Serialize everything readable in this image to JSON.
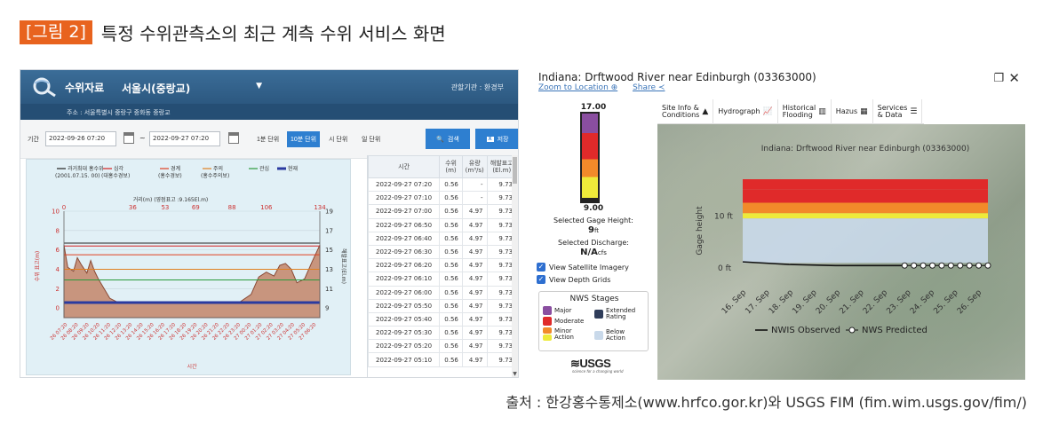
{
  "figure": {
    "tag": "[그림 2]",
    "title": "특정 수위관측소의 최근 계측 수위 서비스 화면",
    "caption": "출처 : 한강홍수통제소(www.hrfco.gor.kr)와 USGS FIM (fim.wim.usgs.gov/fim/)"
  },
  "hrfco": {
    "category": "수위자료",
    "station": "서울시(중랑교)",
    "agency": "관할기관 : 환경부",
    "address": "주소 : 서울특별시 중랑구 중화동 중랑교",
    "period_label": "기간",
    "start_date": "2022-09-26 07:20",
    "end_date": "2022-09-27 07:20",
    "tilde": "~",
    "units": [
      "1분 단위",
      "10분 단위",
      "시 단위",
      "일 단위"
    ],
    "active_unit_index": 1,
    "search_label": "검색",
    "save_label": "저장",
    "colors": {
      "header": "#2c5880",
      "button": "#2e7fd0"
    },
    "legend": [
      {
        "label": "과거최대 홍수위",
        "sub": "(2001.07.15. 00)",
        "color": "#222222"
      },
      {
        "label": "심각",
        "sub": "(대홍수경보)",
        "color": "#d62020"
      },
      {
        "label": "경계",
        "sub": "(홍수경보)",
        "color": "#e04020"
      },
      {
        "label": "주의",
        "sub": "(홍수주의보)",
        "color": "#e08020"
      },
      {
        "label": "관심",
        "sub": "",
        "color": "#2a9a3a"
      },
      {
        "label": "현재",
        "sub": "",
        "color": "#2a3aa0"
      }
    ],
    "table": {
      "headers": [
        "시간",
        "수위\n(m)",
        "유량\n(m³/s)",
        "해발표고\n(El.m)"
      ],
      "rows": [
        [
          "2022-09-27 07:20",
          "0.56",
          "-",
          "9.73"
        ],
        [
          "2022-09-27 07:10",
          "0.56",
          "-",
          "9.73"
        ],
        [
          "2022-09-27 07:00",
          "0.56",
          "4.97",
          "9.73"
        ],
        [
          "2022-09-27 06:50",
          "0.56",
          "4.97",
          "9.73"
        ],
        [
          "2022-09-27 06:40",
          "0.56",
          "4.97",
          "9.73"
        ],
        [
          "2022-09-27 06:30",
          "0.56",
          "4.97",
          "9.73"
        ],
        [
          "2022-09-27 06:20",
          "0.56",
          "4.97",
          "9.73"
        ],
        [
          "2022-09-27 06:10",
          "0.56",
          "4.97",
          "9.73"
        ],
        [
          "2022-09-27 06:00",
          "0.56",
          "4.97",
          "9.73"
        ],
        [
          "2022-09-27 05:50",
          "0.56",
          "4.97",
          "9.73"
        ],
        [
          "2022-09-27 05:40",
          "0.56",
          "4.97",
          "9.73"
        ],
        [
          "2022-09-27 05:30",
          "0.56",
          "4.97",
          "9.73"
        ],
        [
          "2022-09-27 05:20",
          "0.56",
          "4.97",
          "9.73"
        ],
        [
          "2022-09-27 05:10",
          "0.56",
          "4.97",
          "9.73"
        ]
      ]
    }
  },
  "usgs": {
    "title": "Indiana: Drftwood River near Edinburgh (03363000)",
    "zoom_link": "Zoom to Location",
    "share_link": "Share",
    "gage_top": "17.00",
    "gage_bottom": "9.00",
    "selected_height_label": "Selected Gage Height:",
    "selected_height_value": "9",
    "selected_height_unit": "ft",
    "selected_discharge_label": "Selected Discharge:",
    "selected_discharge_value": "N/A",
    "selected_discharge_unit": "cfs",
    "view_satellite": "View Satellite Imagery",
    "view_depth": "View Depth Grids",
    "stages_title": "NWS Stages",
    "stage_labels": {
      "major": "Major",
      "moderate": "Moderate",
      "minor": "Minor\nAction",
      "extended": "Extended\nRating",
      "below": "Below\nAction"
    },
    "stage_colors": {
      "major": "#8a4ea0",
      "moderate": "#e02a2a",
      "minor": "#f28a2a",
      "action": "#eeea3a",
      "extended": "#2f3d5a",
      "below": "#c9d9ea"
    },
    "usgs_logo": "≋USGS",
    "usgs_tagline": "science for a changing world",
    "tabs": [
      {
        "label": "Site Info &\nConditions",
        "icon": "triangle-icon"
      },
      {
        "label": "Hydrograph",
        "icon": "line-chart-icon"
      },
      {
        "label": "Historical\nFlooding",
        "icon": "bar-chart-icon"
      },
      {
        "label": "Hazus",
        "icon": "building-icon"
      },
      {
        "label": "Services\n& Data",
        "icon": "list-icon"
      }
    ],
    "legend": {
      "observed": "NWIS Observed",
      "predicted": "NWS Predicted"
    }
  },
  "chart_data": [
    {
      "type": "area",
      "title": "",
      "top_axis_label": "거리(m) (영점표고 :9.165El.m)",
      "top_ticks": [
        0,
        36,
        53,
        69,
        88,
        106,
        134
      ],
      "ylabel": "수위 표고(m)",
      "y2label": "해발표고(El.m)",
      "ylim": [
        -1,
        10
      ],
      "y_ticks": [
        0,
        2,
        4,
        6,
        8,
        10
      ],
      "y2_ticks": [
        9,
        11,
        13,
        15,
        17,
        19
      ],
      "xlabel": "시간",
      "x": [
        "26 07:20",
        "26 08:20",
        "26 09:20",
        "26 10:20",
        "26 11:20",
        "26 12:20",
        "26 13:20",
        "26 14:20",
        "26 15:20",
        "26 16:20",
        "26 17:20",
        "26 18:20",
        "26 19:20",
        "26 20:20",
        "26 21:20",
        "26 22:20",
        "26 23:20",
        "27 00:20",
        "27 01:20",
        "27 02:20",
        "27 03:20",
        "27 04:20",
        "27 05:20",
        "27 06:20"
      ],
      "threshold_lines": [
        {
          "name": "과거최대 홍수위",
          "value": 6.7
        },
        {
          "name": "심각",
          "value": 6.4
        },
        {
          "name": "경계",
          "value": 5.5
        },
        {
          "name": "주의",
          "value": 4.0
        },
        {
          "name": "관심",
          "value": 2.9
        },
        {
          "name": "현재",
          "value": 0.56
        }
      ],
      "cross_section_profile": [
        [
          0,
          6.5
        ],
        [
          2,
          4.2
        ],
        [
          5,
          3.8
        ],
        [
          7,
          5.2
        ],
        [
          9,
          4.5
        ],
        [
          12,
          3.6
        ],
        [
          14,
          4.9
        ],
        [
          16,
          3.8
        ],
        [
          18,
          3.0
        ],
        [
          21,
          2.0
        ],
        [
          24,
          1.0
        ],
        [
          28,
          0.6
        ],
        [
          50,
          0.6
        ],
        [
          70,
          0.6
        ],
        [
          92,
          0.6
        ],
        [
          98,
          1.4
        ],
        [
          102,
          3.2
        ],
        [
          106,
          3.7
        ],
        [
          110,
          3.3
        ],
        [
          113,
          4.4
        ],
        [
          116,
          4.6
        ],
        [
          119,
          4.0
        ],
        [
          122,
          2.6
        ],
        [
          126,
          3.0
        ],
        [
          130,
          4.8
        ],
        [
          134,
          6.5
        ]
      ]
    },
    {
      "type": "line",
      "title": "Indiana: Drftwood River near Edinburgh (03363000)",
      "ylabel": "Gage height",
      "y_ticks_label": [
        "0 ft",
        "10 ft"
      ],
      "ylim": [
        -2,
        17
      ],
      "x_ticks": [
        "16. Sep",
        "17. Sep",
        "18. Sep",
        "19. Sep",
        "20. Sep",
        "21. Sep",
        "22. Sep",
        "23. Sep",
        "24. Sep",
        "25. Sep",
        "26. Sep"
      ],
      "bands": [
        {
          "name": "Major",
          "from": 15,
          "to": 17
        },
        {
          "name": "Moderate",
          "from": 12.5,
          "to": 15
        },
        {
          "name": "Minor",
          "from": 10.5,
          "to": 12.5
        },
        {
          "name": "Action",
          "from": 9.5,
          "to": 10.5
        },
        {
          "name": "Below Action",
          "from": 1,
          "to": 9.5
        }
      ],
      "series": [
        {
          "name": "NWIS Observed",
          "x": [
            0,
            2,
            4,
            6,
            7
          ],
          "y": [
            1.2,
            0.7,
            0.5,
            0.5,
            0.5
          ]
        },
        {
          "name": "NWS Predicted",
          "x": [
            7,
            7.4,
            7.8,
            8.2,
            8.6,
            9,
            9.4,
            9.8,
            10.2,
            10.6
          ],
          "y": [
            0.5,
            0.5,
            0.5,
            0.5,
            0.5,
            0.5,
            0.5,
            0.5,
            0.5,
            0.5
          ]
        }
      ]
    }
  ]
}
